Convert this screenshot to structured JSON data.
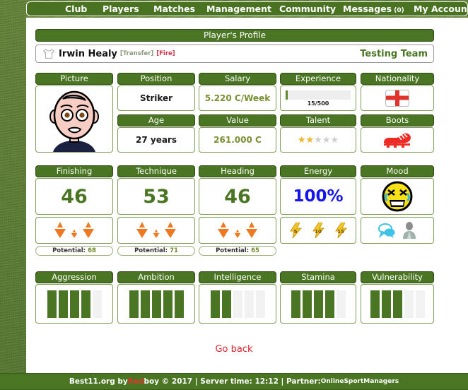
{
  "navbar": {
    "items": [
      {
        "label": "Club"
      },
      {
        "label": "Players"
      },
      {
        "label": "Matches"
      },
      {
        "label": "Management"
      },
      {
        "label": "Community"
      },
      {
        "label": "Messages",
        "count": "(0)"
      },
      {
        "label": "My Account"
      }
    ]
  },
  "header": {
    "title": "Player's Profile"
  },
  "player": {
    "name": "Irwin Healy",
    "transfer_label": "[Transfer]",
    "fire_label": "[Fire]",
    "team": "Testing Team"
  },
  "info_cards": {
    "picture_label": "Picture",
    "position_label": "Position",
    "position_value": "Striker",
    "salary_label": "Salary",
    "salary_value": "5.220 C/Week",
    "experience_label": "Experience",
    "experience_value": "15/500",
    "experience_current": 15,
    "experience_max": 500,
    "nationality_label": "Nationality",
    "nationality_flag": "england-flag-icon",
    "age_label": "Age",
    "age_value": "27 years",
    "value_label": "Value",
    "value_value": "261.000 C",
    "talent_label": "Talent",
    "talent_stars": 2,
    "talent_stars_max": 5,
    "boots_label": "Boots",
    "boots_icon": "football-boot-icon"
  },
  "skills": [
    {
      "label": "Finishing",
      "value": "46",
      "potential_label": "Potential:",
      "potential_value": "68"
    },
    {
      "label": "Technique",
      "value": "53",
      "potential_label": "Potential:",
      "potential_value": "71"
    },
    {
      "label": "Heading",
      "value": "46",
      "potential_label": "Potential:",
      "potential_value": "65"
    }
  ],
  "energy": {
    "label": "Energy",
    "value": "100%",
    "bolts": [
      "5",
      "10",
      "15"
    ]
  },
  "mood": {
    "label": "Mood",
    "face_icon": "angry-crying-face-icon",
    "actions": [
      "speech-bubble-icon",
      "manager-person-icon"
    ]
  },
  "attributes": [
    {
      "label": "Aggression",
      "filled": 4,
      "total": 5
    },
    {
      "label": "Ambition",
      "filled": 5,
      "total": 5
    },
    {
      "label": "Intelligence",
      "filled": 2,
      "total": 5
    },
    {
      "label": "Stamina",
      "filled": 4,
      "total": 5
    },
    {
      "label": "Vulnerability",
      "filled": 3,
      "total": 5
    }
  ],
  "go_back_label": "Go back",
  "footer": {
    "prefix": "Best11.org by ",
    "brand_red": "Red",
    "brand_rest": "boy © 2017 | Server time: 12:12 | Partner: ",
    "partner": "OnlineSportManagers"
  },
  "colors": {
    "green": "#4a7523",
    "money": "#7a8f33",
    "energy_blue": "#1414ee",
    "red": "#d43b2a"
  }
}
